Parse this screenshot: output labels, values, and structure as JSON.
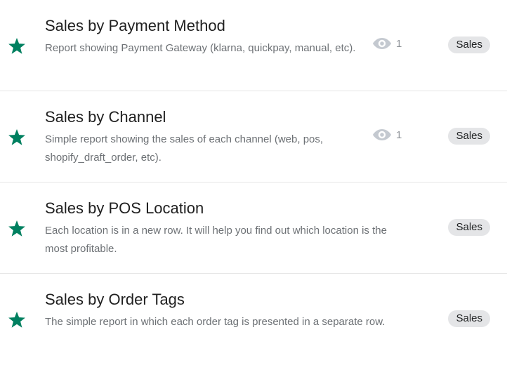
{
  "colors": {
    "star": "#008060",
    "tag_bg": "#e4e5e7",
    "eye": "#c4c9d0",
    "description_text": "#6d7175"
  },
  "reports": [
    {
      "starred": true,
      "star_icon": "star-icon",
      "title": "Sales by Payment Method",
      "description": "Report showing Payment Gateway (klarna, quickpay, manual, etc).",
      "views_icon": "eye-icon",
      "views": "1",
      "tag": "Sales"
    },
    {
      "starred": true,
      "star_icon": "star-icon",
      "title": "Sales by Channel",
      "description": "Simple report showing the sales of each channel (web, pos, shopify_draft_order, etc).",
      "views_icon": "eye-icon",
      "views": "1",
      "tag": "Sales"
    },
    {
      "starred": true,
      "star_icon": "star-icon",
      "title": "Sales by POS Location",
      "description": "Each location is in a new row. It will help you find out which location is the most profitable.",
      "tag": "Sales"
    },
    {
      "starred": true,
      "star_icon": "star-icon",
      "title": "Sales by Order Tags",
      "description": "The simple report in which each order tag is presented in a separate row.",
      "tag": "Sales"
    }
  ]
}
